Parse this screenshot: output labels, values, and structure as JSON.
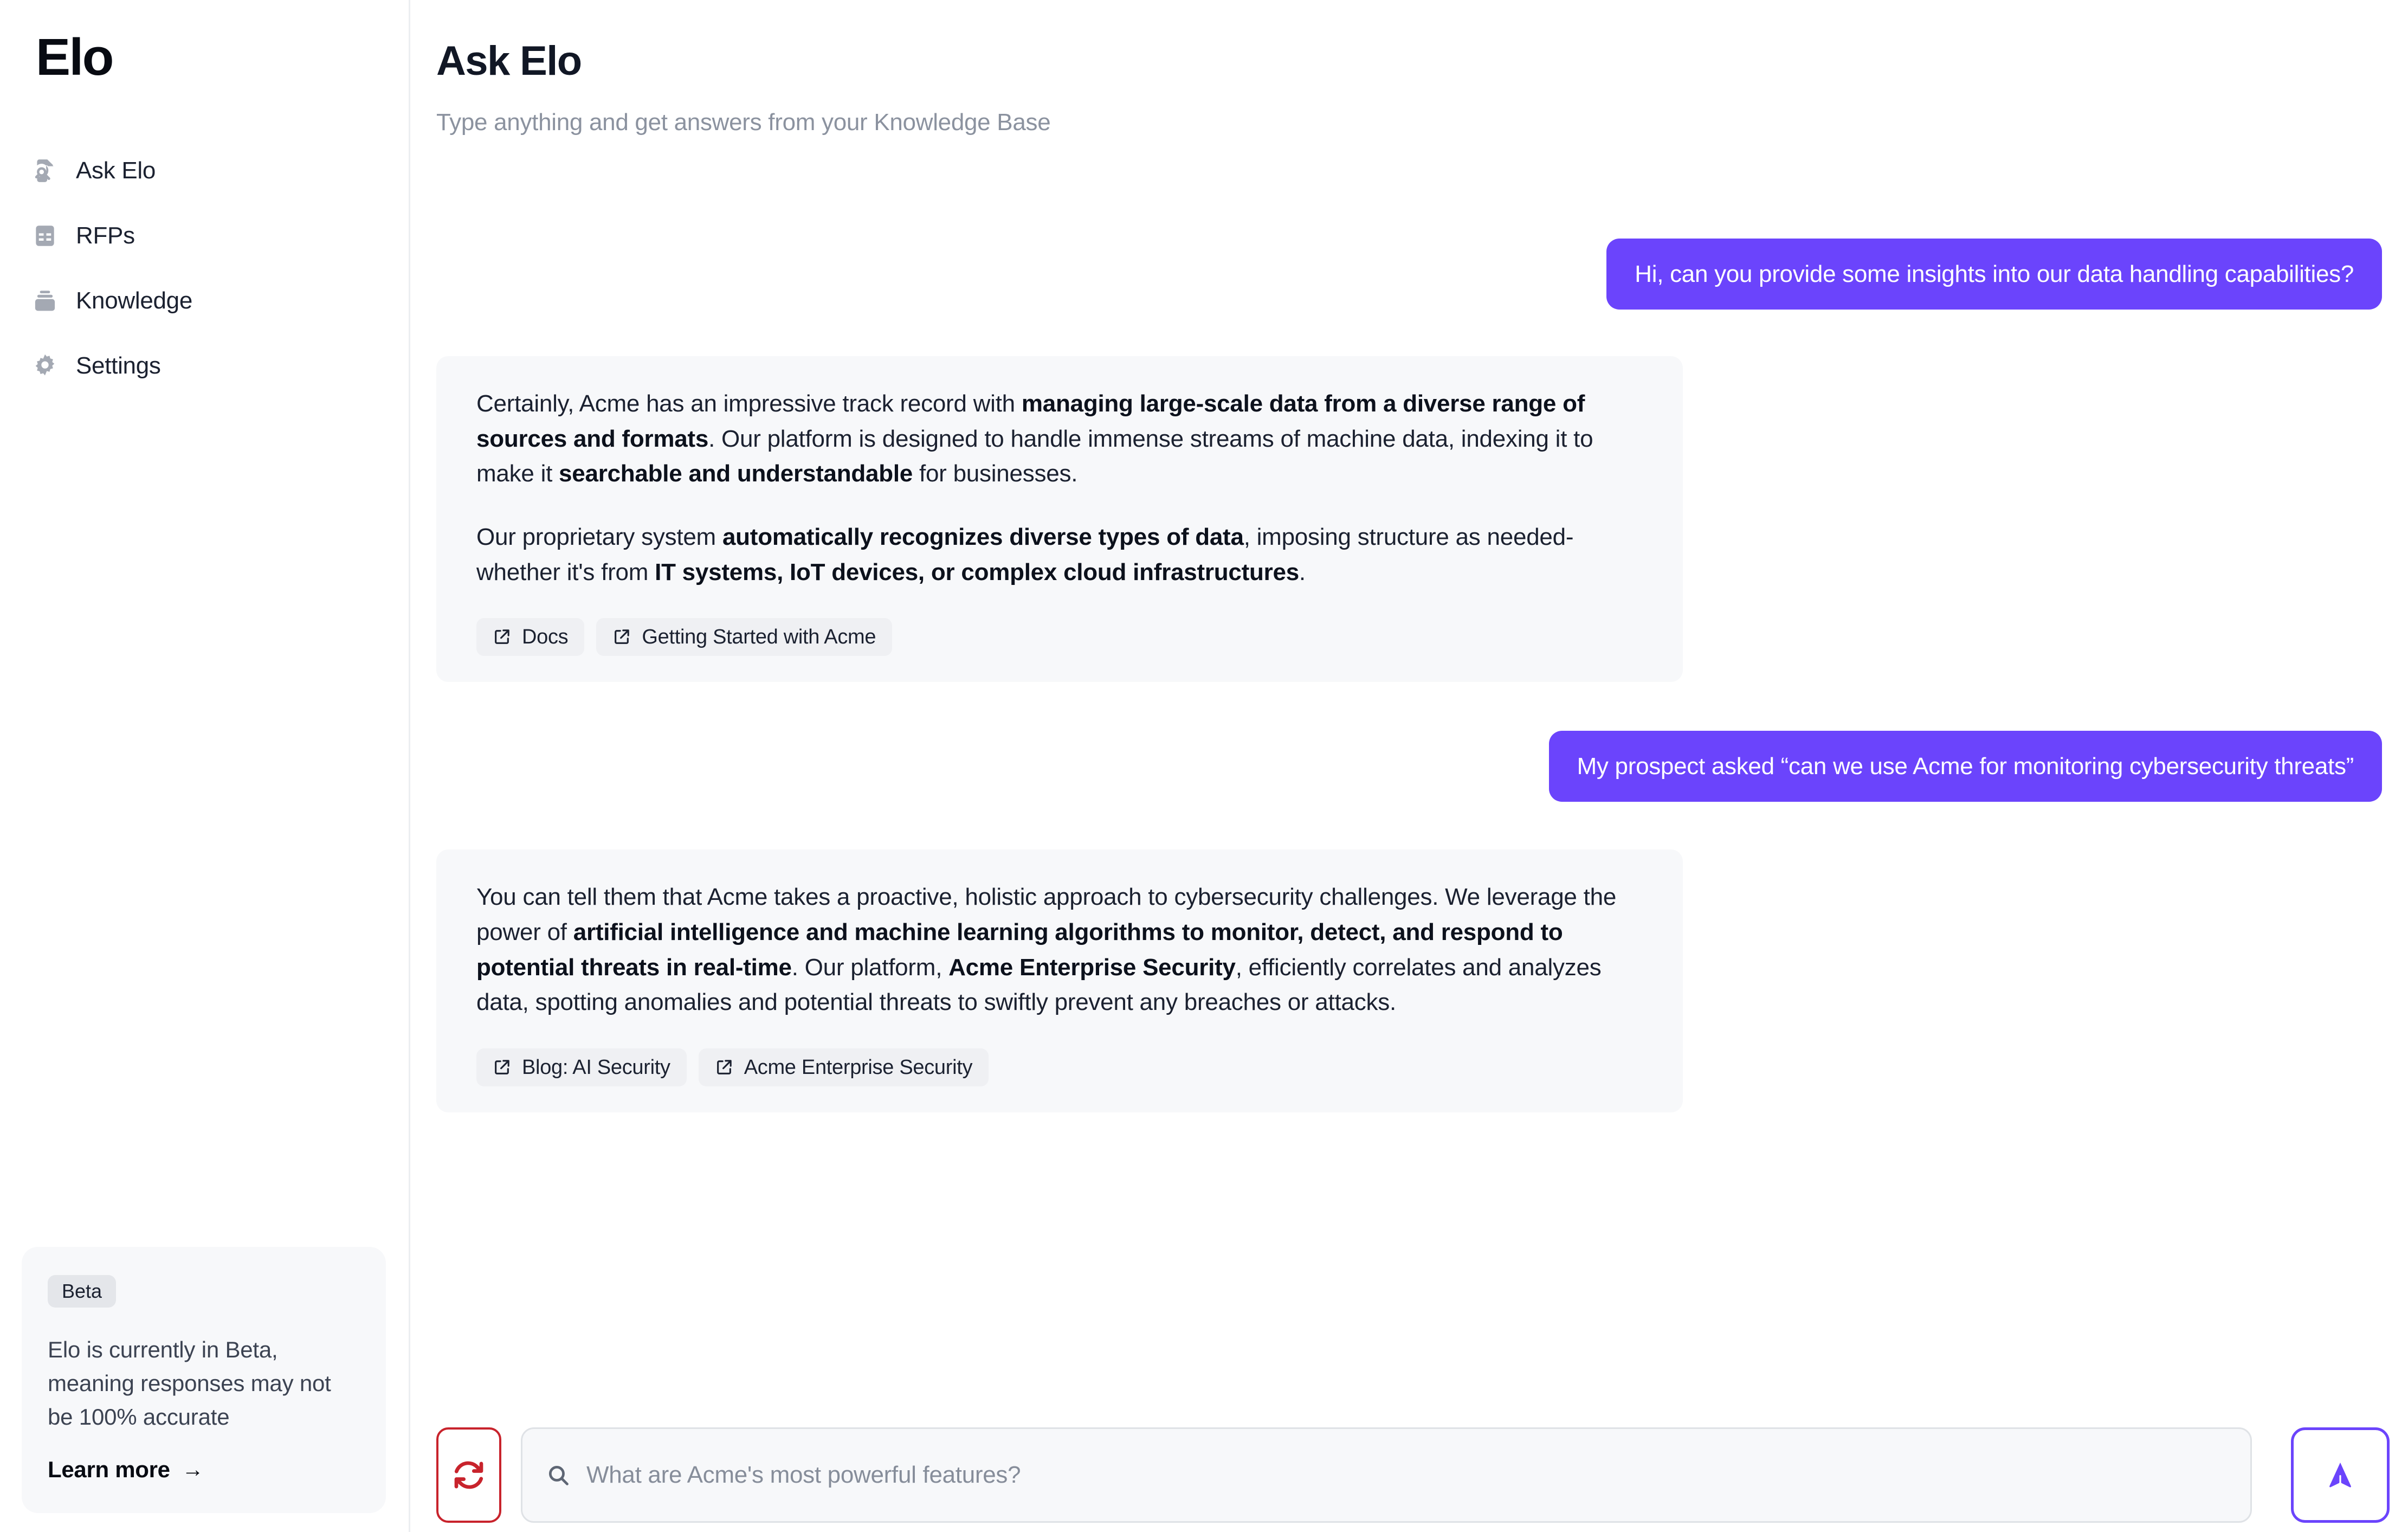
{
  "sidebar": {
    "brand": "Elo",
    "items": [
      {
        "label": "Ask Elo",
        "icon": "file-search-icon"
      },
      {
        "label": "RFPs",
        "icon": "table-icon"
      },
      {
        "label": "Knowledge",
        "icon": "archive-icon"
      },
      {
        "label": "Settings",
        "icon": "gear-icon"
      }
    ],
    "beta": {
      "badge": "Beta",
      "text": "Elo is currently in Beta, meaning responses may not be 100% accurate",
      "link": "Learn more",
      "link_arrow": "→"
    }
  },
  "header": {
    "title": "Ask Elo",
    "subtitle": "Type anything and get answers from your Knowledge Base"
  },
  "chat": {
    "messages": [
      {
        "role": "user",
        "text": "Hi, can you provide some insights into our data handling capabilities?"
      },
      {
        "role": "assistant",
        "paragraph1_a": "Certainly, Acme has an impressive track record with ",
        "paragraph1_b": "managing large-scale data from a diverse range of sources and formats",
        "paragraph1_c": ". Our platform is designed to handle immense streams of machine data, indexing it to make it ",
        "paragraph1_d": "searchable and understandable",
        "paragraph1_e": " for businesses.",
        "paragraph2_a": "Our proprietary system ",
        "paragraph2_b": "automatically recognizes diverse types of data",
        "paragraph2_c": ", imposing structure as needed-whether it's from ",
        "paragraph2_d": "IT systems, IoT devices, or complex cloud infrastructures",
        "paragraph2_e": ".",
        "citations": [
          "Docs",
          "Getting Started with Acme"
        ]
      },
      {
        "role": "user",
        "text": "My prospect asked “can we use Acme for monitoring cybersecurity threats”"
      },
      {
        "role": "assistant",
        "paragraph1_a": "You can tell them that Acme takes a proactive, holistic approach to cybersecurity challenges. We leverage the power of ",
        "paragraph1_b": "artificial intelligence and machine learning algorithms to monitor, detect, and respond to potential threats in real-time",
        "paragraph1_c": ". Our platform, ",
        "paragraph1_d": "Acme Enterprise Security",
        "paragraph1_e": ", efficiently correlates and analyzes data, spotting anomalies and potential threats to swiftly prevent any breaches or attacks.",
        "citations": [
          "Blog: AI Security",
          "Acme Enterprise Security"
        ]
      }
    ]
  },
  "composer": {
    "reset_icon": "refresh-icon",
    "search_icon": "search-icon",
    "placeholder": "What are Acme's most powerful features?",
    "value": "",
    "send_icon": "send-arrow-icon"
  },
  "colors": {
    "accent_purple": "#6b44fc",
    "reset_red": "#c8232c",
    "bubble_bg": "#f7f8fa",
    "chip_bg": "#eff0f3",
    "text_dark": "#1b2130",
    "text_muted": "#8b929f"
  }
}
